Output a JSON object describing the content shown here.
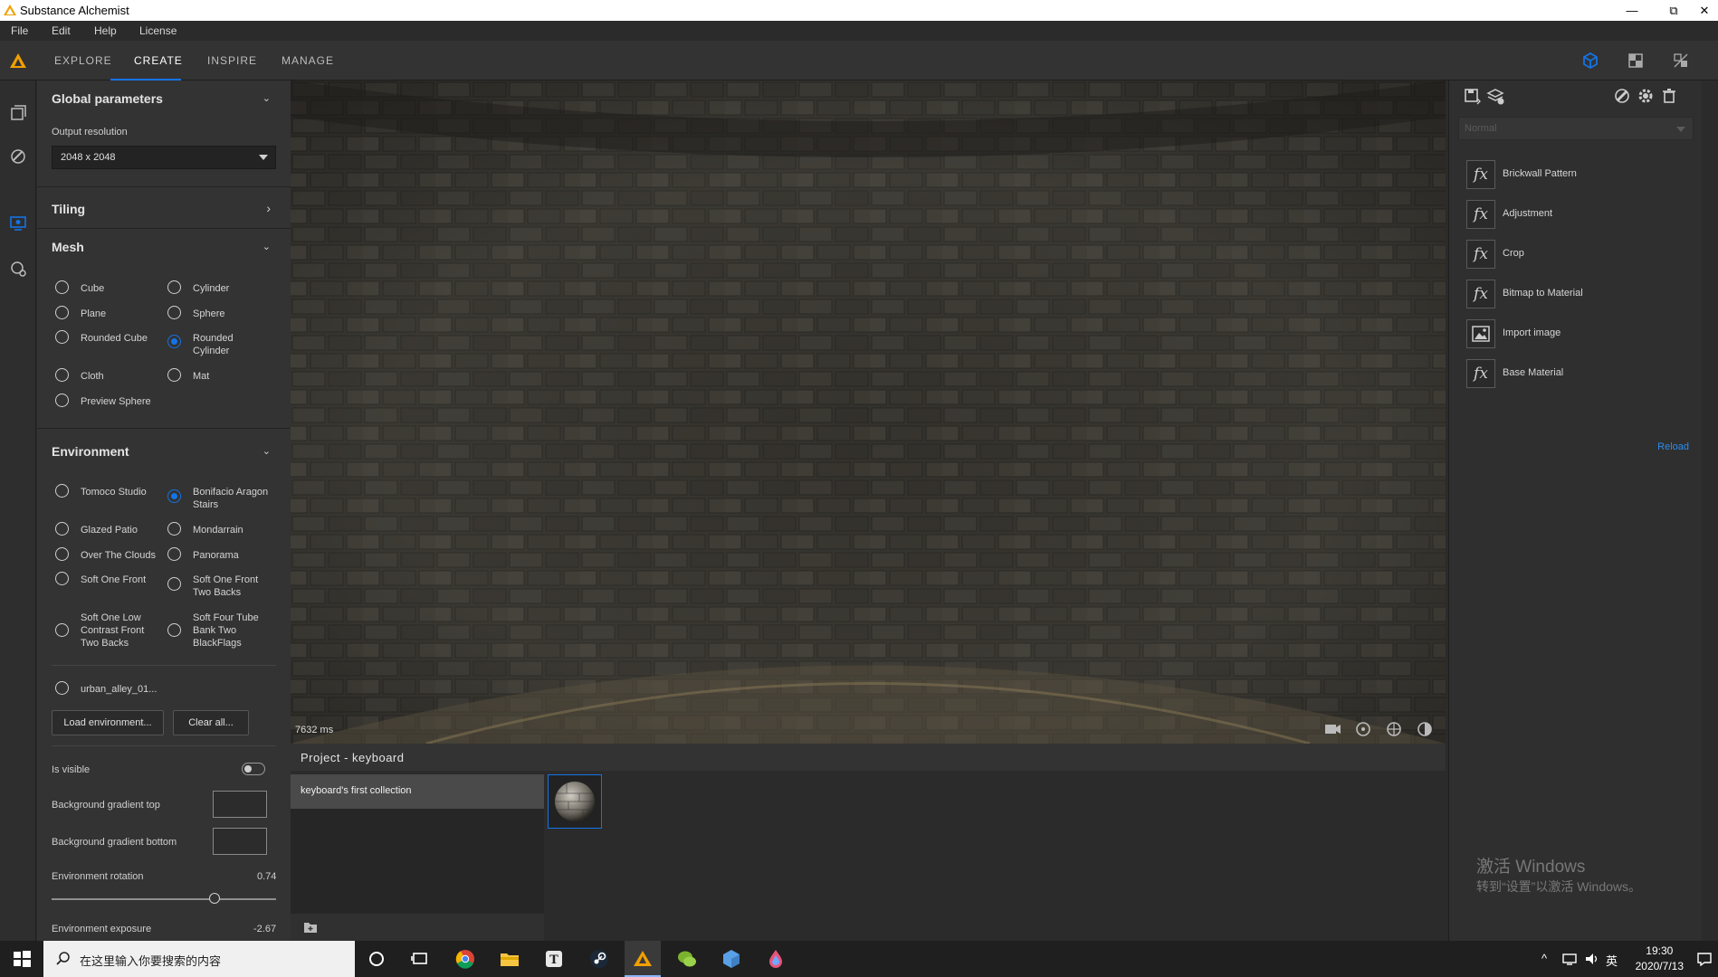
{
  "window": {
    "title": "Substance Alchemist",
    "minimize": "—",
    "restore": "⧉",
    "close": "✕"
  },
  "menu": [
    "File",
    "Edit",
    "Help",
    "License"
  ],
  "nav": {
    "tabs": [
      "EXPLORE",
      "CREATE",
      "INSPIRE",
      "MANAGE"
    ],
    "active": "CREATE"
  },
  "left_panel": {
    "global": {
      "title": "Global parameters",
      "output_label": "Output resolution",
      "output_value": "2048 x 2048"
    },
    "tiling": {
      "title": "Tiling"
    },
    "mesh": {
      "title": "Mesh",
      "options": [
        "Cube",
        "Cylinder",
        "Plane",
        "Sphere",
        "Rounded Cube",
        "Rounded Cylinder",
        "Cloth",
        "Mat",
        "Preview Sphere"
      ],
      "selected": "Rounded Cylinder"
    },
    "environment": {
      "title": "Environment",
      "options": [
        "Tomoco Studio",
        "Bonifacio Aragon Stairs",
        "Glazed Patio",
        "Mondarrain",
        "Over The Clouds",
        "Panorama",
        "Soft One Front",
        "Soft One Front Two Backs",
        "Soft One Low Contrast Front Two Backs",
        "Soft Four Tube Bank Two BlackFlags",
        "urban_alley_01..."
      ],
      "selected": "Bonifacio Aragon Stairs",
      "load_button": "Load environment...",
      "clear_button": "Clear all...",
      "is_visible_label": "Is visible",
      "is_visible": false,
      "bg_top_label": "Background gradient top",
      "bg_bottom_label": "Background gradient bottom",
      "rotation_label": "Environment rotation",
      "rotation_value": "0.74",
      "exposure_label": "Environment exposure",
      "exposure_value": "-2.67"
    }
  },
  "viewport": {
    "render_time": "7632 ms"
  },
  "project": {
    "title": "Project - keyboard",
    "collection": "keyboard's first collection"
  },
  "right_panel": {
    "blend_mode": "Normal",
    "stack": [
      {
        "icon": "fx",
        "name": "Brickwall Pattern"
      },
      {
        "icon": "fx",
        "name": "Adjustment"
      },
      {
        "icon": "fx",
        "name": "Crop"
      },
      {
        "icon": "fx",
        "name": "Bitmap to Material"
      },
      {
        "icon": "image",
        "name": "Import image"
      },
      {
        "icon": "fx",
        "name": "Base Material"
      }
    ],
    "reload": "Reload",
    "watermark_line1": "激活 Windows",
    "watermark_line2": "转到“设置”以激活 Windows。"
  },
  "taskbar": {
    "search_placeholder": "在这里输入你要搜索的内容",
    "time": "19:30",
    "date": "2020/7/13",
    "ime": "英"
  },
  "colors": {
    "accent": "#1473e6",
    "panel": "#333333",
    "link": "#2d8ceb"
  }
}
